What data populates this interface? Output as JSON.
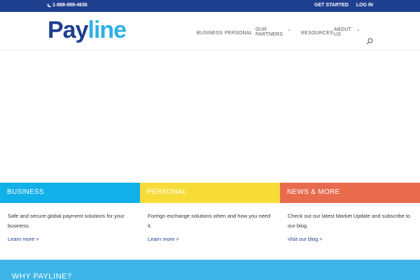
{
  "topbar": {
    "phone": "1-888-989-4636",
    "get_started": "GET STARTED",
    "login": "LOG IN"
  },
  "logo": {
    "part1": "Pay",
    "part2": "line"
  },
  "nav": {
    "business": "BUSINESS",
    "personal": "PERSONAL",
    "our_partners_1": "OUR",
    "our_partners_2": "PARTNERS",
    "resources": "RESOURCES",
    "about_1": "ABOUT",
    "about_2": "US"
  },
  "columns": [
    {
      "heading": "BUSINESS",
      "desc": "Safe and secure global payment solutions for your business.",
      "link": "Learn more >"
    },
    {
      "heading": "PERSONAL",
      "desc": "Foreign exchange solutions when and how you need it.",
      "link": "Learn more >"
    },
    {
      "heading": "NEWS & MORE",
      "desc": "Check out our latest Market Update and subscribe to our blog.",
      "link": "Visit our blog >"
    }
  ],
  "why": {
    "title": "WHY PAYLINE?"
  },
  "colors": {
    "topbar": "#1f3f8f",
    "logo_pay": "#1e3e8e",
    "logo_line": "#2fb0e4",
    "business": "#11b0e8",
    "personal": "#f7dc38",
    "news": "#e96b4e",
    "why": "#3cb4e6"
  }
}
